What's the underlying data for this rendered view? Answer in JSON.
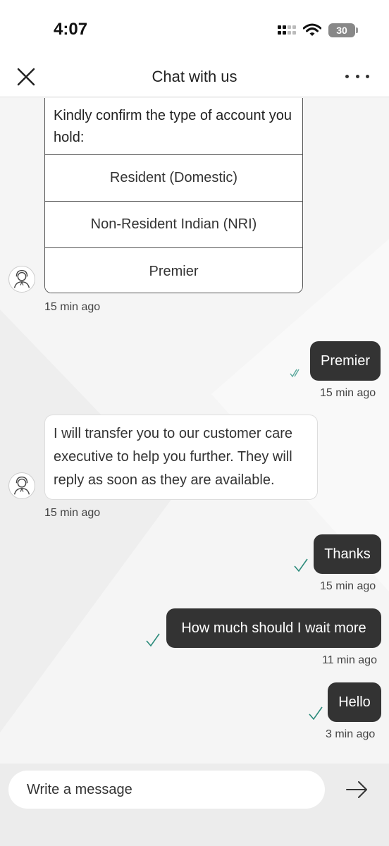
{
  "status_bar": {
    "time": "4:07",
    "battery": "30"
  },
  "header": {
    "title": "Chat with us"
  },
  "messages": {
    "options_card": {
      "question": "Kindly confirm the type of account you hold:",
      "options": [
        "Resident (Domestic)",
        "Non-Resident Indian (NRI)",
        "Premier"
      ],
      "time": "15 min ago"
    },
    "user_premier": {
      "text": "Premier",
      "time": "15 min ago"
    },
    "bot_transfer": {
      "lines": [
        "I will transfer you to our customer care",
        "executive to help you further. They will",
        "reply as soon as they are available."
      ],
      "time": "15 min ago"
    },
    "user_thanks": {
      "text": "Thanks",
      "time": "15 min ago"
    },
    "user_wait": {
      "text": "How much should I wait more",
      "time": "11 min ago"
    },
    "user_hello": {
      "text": "Hello",
      "time": "3 min ago"
    }
  },
  "composer": {
    "placeholder": "Write a message"
  },
  "colors": {
    "user_bubble": "#333333",
    "tick": "#2a8a7a",
    "read_tick": "#5aa89c"
  },
  "icons": [
    "close-icon",
    "more-icon",
    "agent-avatar-icon",
    "double-check-icon",
    "check-icon",
    "send-arrow-icon",
    "wifi-icon",
    "signal-icon",
    "battery-icon"
  ]
}
